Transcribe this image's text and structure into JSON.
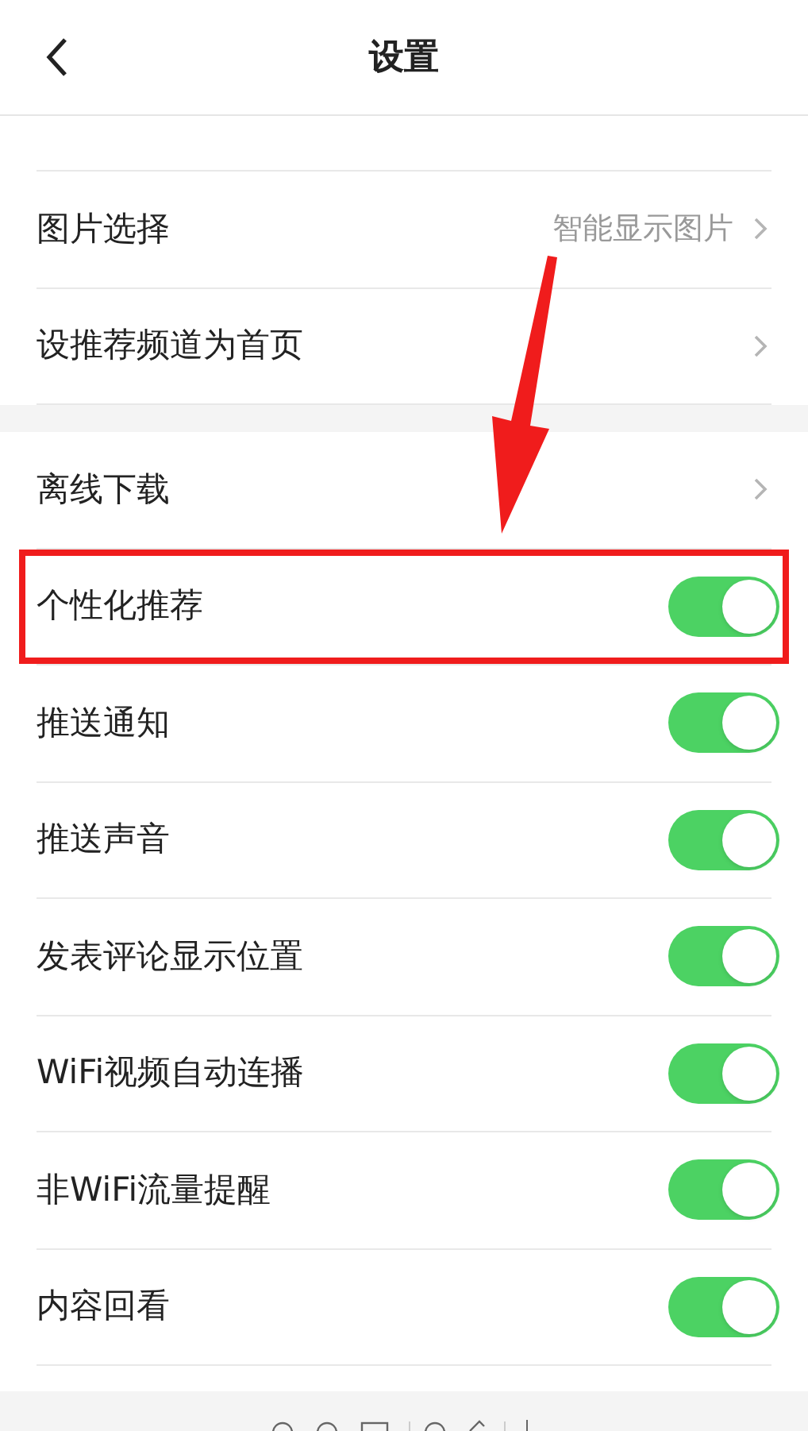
{
  "header": {
    "title": "设置"
  },
  "sections": [
    {
      "rows": [
        {
          "kind": "link",
          "label": "图片选择",
          "value": "智能显示图片",
          "highlighted": false
        },
        {
          "kind": "link",
          "label": "设推荐频道为首页",
          "highlighted": false
        }
      ]
    },
    {
      "rows": [
        {
          "kind": "link",
          "label": "离线下载",
          "highlighted": false
        },
        {
          "kind": "toggle",
          "label": "个性化推荐",
          "on": true,
          "highlighted": true
        },
        {
          "kind": "toggle",
          "label": "推送通知",
          "on": true,
          "highlighted": false
        },
        {
          "kind": "toggle",
          "label": "推送声音",
          "on": true,
          "highlighted": false
        },
        {
          "kind": "toggle",
          "label": "发表评论显示位置",
          "on": true,
          "highlighted": false
        },
        {
          "kind": "toggle",
          "label": "WiFi视频自动连播",
          "on": true,
          "highlighted": false
        },
        {
          "kind": "toggle",
          "label": "非WiFi流量提醒",
          "on": true,
          "highlighted": false
        },
        {
          "kind": "toggle",
          "label": "内容回看",
          "on": true,
          "highlighted": false
        }
      ]
    }
  ]
}
